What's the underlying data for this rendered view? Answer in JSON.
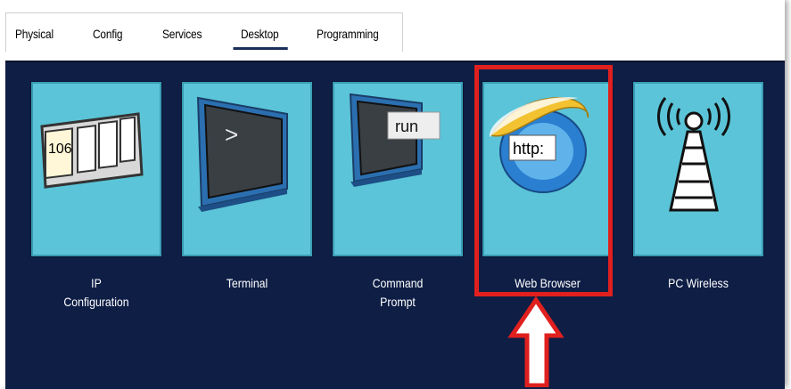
{
  "tabs": [
    {
      "label": "Physical"
    },
    {
      "label": "Config"
    },
    {
      "label": "Services"
    },
    {
      "label": "Desktop",
      "active": true
    },
    {
      "label": "Programming"
    }
  ],
  "apps": [
    {
      "label": "IP\nConfiguration",
      "icon": "ip-configuration-icon",
      "icon_text": "106"
    },
    {
      "label": "Terminal",
      "icon": "terminal-icon",
      "icon_text": ">"
    },
    {
      "label": "Command\nPrompt",
      "icon": "command-prompt-icon",
      "icon_text": "run"
    },
    {
      "label": "Web Browser",
      "icon": "web-browser-icon",
      "icon_text": "http:"
    },
    {
      "label": "PC Wireless",
      "icon": "pc-wireless-icon",
      "icon_text": "((( )))"
    }
  ],
  "colors": {
    "desktop_bg": "#0e1e45",
    "tile_bg": "#5bc4d8",
    "highlight": "#e0201e",
    "active_tab_underline": "#1b2f5a"
  }
}
